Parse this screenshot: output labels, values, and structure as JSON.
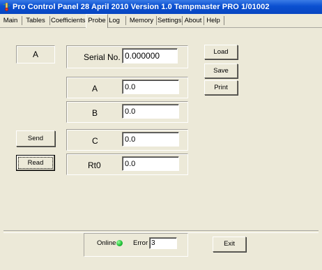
{
  "window": {
    "title": "Pro Control Panel 28 April 2010 Version 1.0   Tempmaster PRO 1/01002"
  },
  "tabs": [
    {
      "label": "Main"
    },
    {
      "label": "Tables"
    },
    {
      "label": "Coefficients"
    },
    {
      "label": "Probe",
      "active": true
    },
    {
      "label": "Log"
    },
    {
      "label": "Memory"
    },
    {
      "label": "Settings"
    },
    {
      "label": "About"
    },
    {
      "label": "Help"
    }
  ],
  "probe": {
    "mode_label": "A",
    "serial_label": "Serial No.",
    "serial_value": "0.000000",
    "coefficients": [
      {
        "label": "A",
        "value": "0.0"
      },
      {
        "label": "B",
        "value": "0.0"
      },
      {
        "label": "C",
        "value": "0.0"
      },
      {
        "label": "Rt0",
        "value": "0.0"
      }
    ]
  },
  "buttons": {
    "load": "Load",
    "save": "Save",
    "print": "Print",
    "send": "Send",
    "read": "Read",
    "exit": "Exit"
  },
  "status": {
    "online_label": "Online",
    "online_color": "#22c43a",
    "error_label": "Error",
    "error_value": "3"
  },
  "colors": {
    "titlebar": "#0a4fd0",
    "window_bg": "#ece9d8"
  }
}
